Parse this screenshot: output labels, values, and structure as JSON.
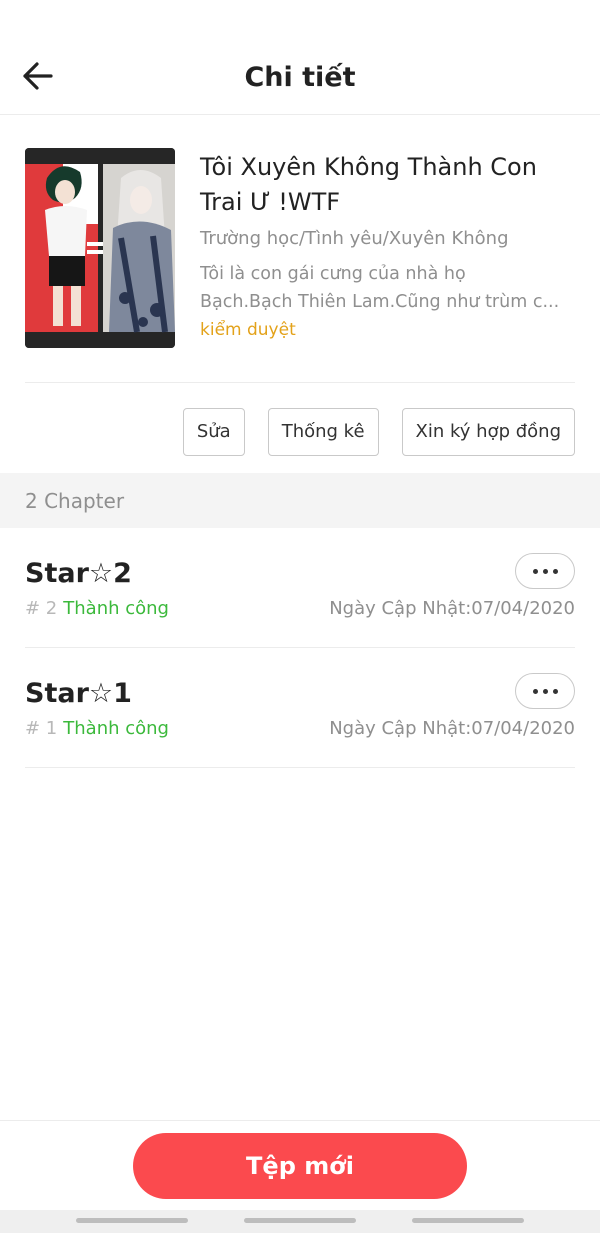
{
  "header": {
    "title": "Chi tiết",
    "back_icon": "arrow-left-icon"
  },
  "book": {
    "title": "Tôi Xuyên Không Thành Con Trai Ư !WTF",
    "genres": "Trường học/Tình yêu/Xuyên Không",
    "description_line1": "Tôi là con gái cưng của nhà họ",
    "description_line2": "Bạch.Bạch Thiên Lam.Cũng như trùm c...",
    "status": "kiểm duyệt"
  },
  "actions": {
    "edit_label": "Sửa",
    "stats_label": "Thống kê",
    "contract_label": "Xin ký hợp đồng"
  },
  "chapter_count": "2 Chapter",
  "chapters": [
    {
      "title": "Star☆2",
      "number": "# 2",
      "status": "Thành công",
      "date": "Ngày Cập Nhật:07/04/2020"
    },
    {
      "title": "Star☆1",
      "number": "# 1",
      "status": "Thành công",
      "date": "Ngày Cập Nhật:07/04/2020"
    }
  ],
  "bottom": {
    "new_button_label": "Tệp mới"
  },
  "colors": {
    "accent": "#fb4a4e",
    "status_success": "#3cb93c",
    "status_review": "#e3a21a"
  }
}
